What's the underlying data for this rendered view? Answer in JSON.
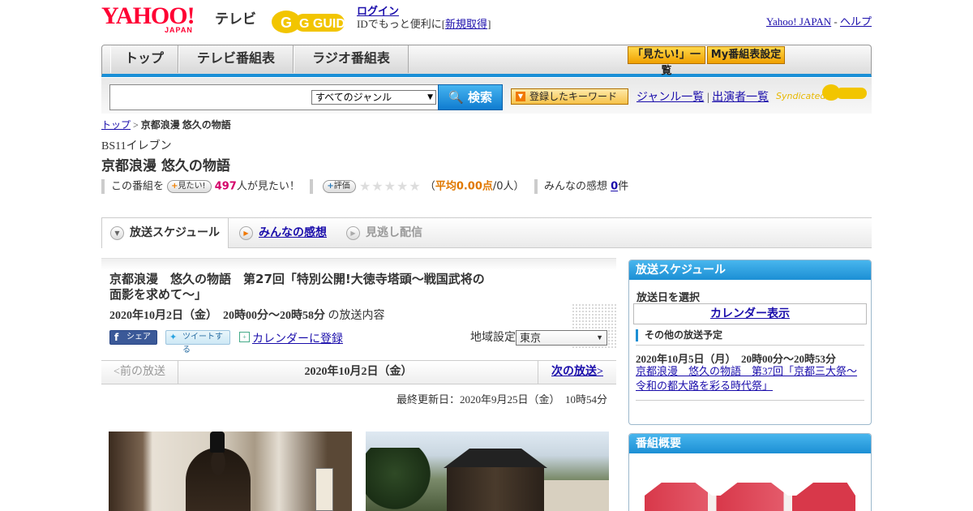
{
  "header": {
    "logo_text": "YAHOO!",
    "logo_sub": "JAPAN",
    "tv_label": "テレビ",
    "gguide_label": "G GUIDE",
    "login": "ログイン",
    "id_text_pre": "IDでもっと便利に[",
    "signup": "新規取得",
    "id_text_post": "]",
    "yahoo_japan": "Yahoo! JAPAN",
    "separator": "-",
    "help": "ヘルプ"
  },
  "nav": {
    "tabs": [
      {
        "label": "トップ"
      },
      {
        "label": "テレビ番組表"
      },
      {
        "label": "ラジオ番組表"
      }
    ],
    "mitai_list": "「見たい!」一覧",
    "my_program": "My番組表設定"
  },
  "search": {
    "placeholder": "",
    "genre": "すべてのジャンル",
    "button": "検索",
    "keyword_button": "登録したキーワード",
    "genre_list": "ジャンル一覧",
    "pipe": "|",
    "performer_list": "出演者一覧",
    "syndicated": "Syndicated"
  },
  "breadcrumb": {
    "top": "トップ",
    "sep": ">",
    "current": "京都浪漫 悠久の物語"
  },
  "program": {
    "station": "BS11イレブン",
    "title": "京都浪漫 悠久の物語",
    "this_program": "この番組を",
    "mitai_btn": "見たい!",
    "mitai_count": "497",
    "mitai_suffix": "人が見たい！",
    "rate_btn": "評価",
    "stars": "★★★★★",
    "avg_open": "（",
    "avg": "平均0.00点",
    "avg_count": "/0人）",
    "reviews_label": "みんなの感想",
    "reviews_count": "0",
    "reviews_unit": "件"
  },
  "subtabs": {
    "schedule": "放送スケジュール",
    "reviews": "みんなの感想",
    "vod": "見逃し配信"
  },
  "episode": {
    "title": "京都浪漫　悠久の物語　第27回「特別公開!大徳寺塔頭～戦国武将の面影を求めて～」",
    "datetime": "2020年10月2日（金）　20時00分～20時58分",
    "datetime_suffix": "の放送内容",
    "share_fb": "シェア",
    "tweet": "ツイートする",
    "calendar": "カレンダーに登録",
    "region_label": "地域設定",
    "region": "東京",
    "prev": "<前の放送",
    "current_date": "2020年10月2日（金）",
    "next": "次の放送>",
    "updated": "最終更新日：2020年9月25日（金）　10時54分"
  },
  "sidebar": {
    "schedule_head": "放送スケジュール",
    "select_date": "放送日を選択",
    "calendar_view": "カレンダー表示",
    "other_label": "その他の放送予定",
    "other_time": "2020年10月5日（月）　20時00分～20時53分",
    "other_title": "京都浪漫　悠久の物語　第37回「京都三大祭～令和の都大路を彩る時代祭」",
    "summary_head": "番組概要"
  },
  "colors": {
    "accent_blue": "#1a8fd6",
    "link": "#1a0dab",
    "magenta": "#d4006a",
    "orange": "#e07800"
  }
}
